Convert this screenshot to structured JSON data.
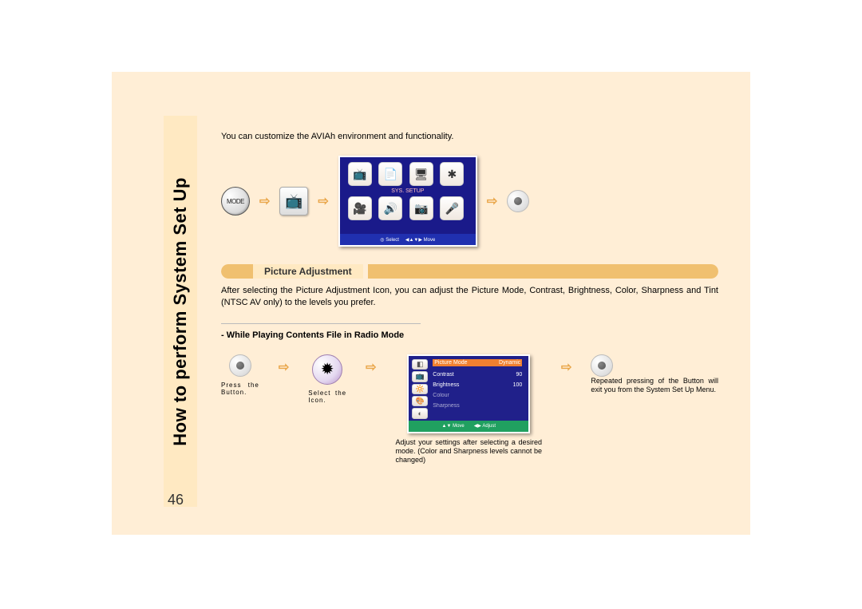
{
  "page_number": "46",
  "vertical_title": "How to perform System Set Up",
  "intro": "You can customize the AVIAh environment and functionality.",
  "mode_button_label": "MODE",
  "screen1": {
    "label": "SYS. SETUP",
    "footer_select": "◎ Select",
    "footer_move": "◀▲▼▶ Move",
    "icons": [
      "📺",
      "📄",
      "🖥",
      "✱",
      "🎥",
      "🔊",
      "📷",
      "🎤"
    ]
  },
  "section_title": "Picture Adjustment",
  "paragraph1": "After selecting the Picture Adjustment Icon, you can adjust the Picture Mode, Contrast, Brightness, Color, Sharpness and Tint (NTSC AV only) to the levels you prefer.",
  "subheading": "- While Playing Contents File in Radio Mode",
  "step1_caption": "Press the Button.",
  "step2_caption": "Select the Icon.",
  "screen2": {
    "rows": [
      {
        "label": "Picture Mode",
        "value": "Dynamic",
        "hl": true
      },
      {
        "label": "Contrast",
        "value": "90"
      },
      {
        "label": "Brightness",
        "value": "100"
      },
      {
        "label": "Colour",
        "value": ""
      },
      {
        "label": "Sharpness",
        "value": ""
      }
    ],
    "footer_move": "▲▼ Move",
    "footer_adjust": "◀▶ Adjust"
  },
  "caption_under_screen2": "Adjust your settings after selecting a desired mode. (Color and Sharpness levels cannot be changed)",
  "caption_right": "Repeated pressing of the Button will exit you from the System Set Up Menu."
}
